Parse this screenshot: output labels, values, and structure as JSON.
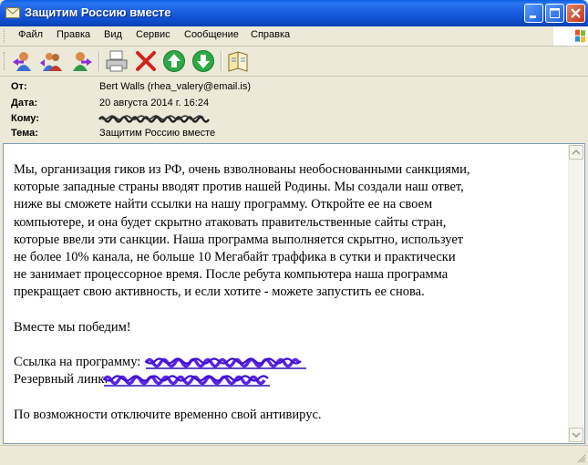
{
  "window": {
    "title": "Защитим Россию вместе"
  },
  "menu": {
    "items": [
      "Файл",
      "Правка",
      "Вид",
      "Сервис",
      "Сообщение",
      "Справка"
    ]
  },
  "toolbar": {
    "icons": [
      "reply-icon",
      "reply-all-icon",
      "forward-icon",
      "print-icon",
      "delete-icon",
      "previous-icon",
      "next-icon",
      "addresses-icon"
    ]
  },
  "header": {
    "from_label": "От:",
    "from_value": "Bert Walls (rhea_valery@email.is)",
    "date_label": "Дата:",
    "date_value": "20 августа 2014 г. 16:24",
    "to_label": "Кому:",
    "subject_label": "Тема:",
    "subject_value": "Защитим Россию вместе"
  },
  "message": {
    "lines": [
      "Мы, организация гиков из РФ, очень взволнованы необоснованными санкциями,",
      "которые западные страны вводят против нашей Родины. Мы создали наш ответ,",
      "ниже вы сможете найти ссылки на нашу программу. Откройте ее на своем",
      "компьютере, и она будет скрытно атаковать правительственные сайты стран,",
      "которые ввели эти санкции. Наша программа выполняется скрытно, использует",
      "не более 10% канала, не больше 10 Мегабайт траффика в сутки и практически",
      "не занимает процессорное время. После ребута компьютера наша программа",
      "прекращает свою активность, и если хотите - можете запустить ее снова."
    ],
    "closing": "Вместе мы победим!",
    "link1_label": "Ссылка на программу:",
    "link2_label": "Резервный линк:",
    "footer": "По возможности отключите временно свой антивирус."
  },
  "colors": {
    "titlebar": "#0a5fe0",
    "redaction_link": "#5a22e8",
    "chrome": "#ece9d8"
  }
}
